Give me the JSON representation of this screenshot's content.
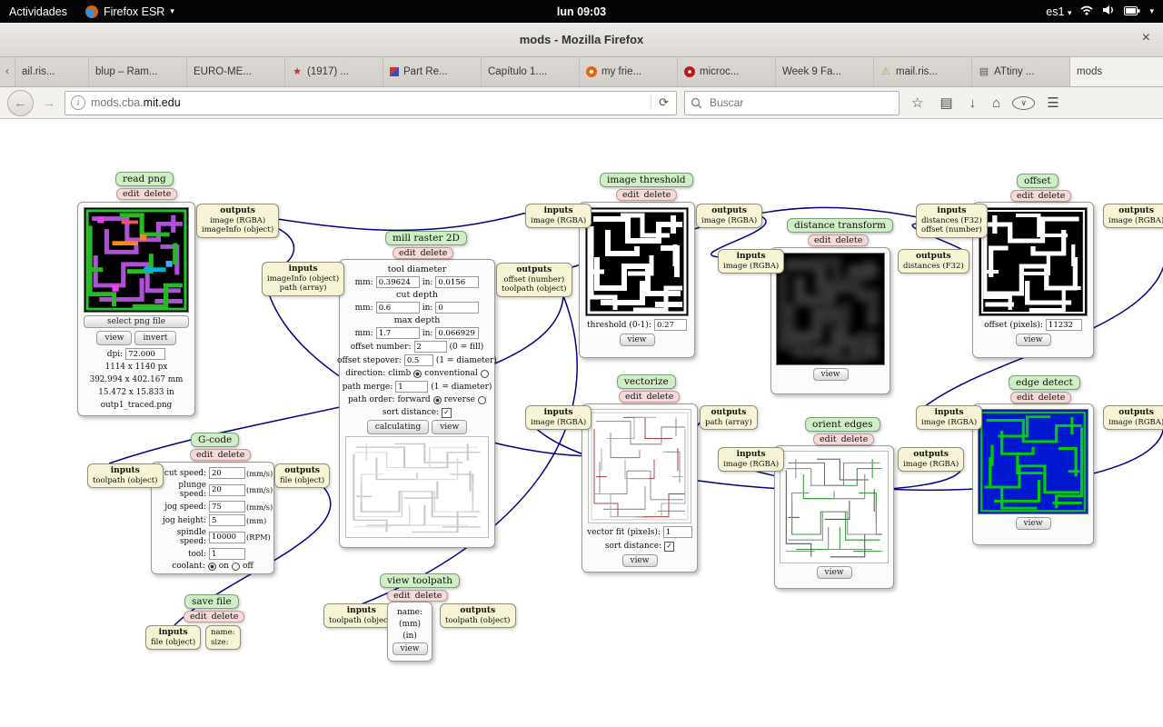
{
  "shell": {
    "activities": "Actividades",
    "app": "Firefox ESR",
    "clock": "lun 09:03",
    "kbd": "es1"
  },
  "window": {
    "title": "mods - Mozilla Firefox"
  },
  "tabbar": {
    "tabs": [
      "ail.ris...",
      "blup – Ram...",
      "EURO-ME...",
      "(1917) ...",
      "Part Re...",
      "Capítulo 1....",
      "my frie...",
      "microc...",
      "Week 9 Fa...",
      "mail.ris...",
      "ATtiny ...",
      "mods"
    ]
  },
  "nav": {
    "url_prefix": "mods.cba.",
    "url_domain": "mit.edu",
    "search_placeholder": "Buscar"
  },
  "glyphs": {
    "back": "←",
    "forward": "→",
    "reload": "⟳",
    "home": "⌂",
    "menu": "☰",
    "download": "↓",
    "bookmark_star": "☆",
    "sidebar": "▤",
    "caret": "▾",
    "scroll_left": "‹",
    "scroll_right": "›",
    "new_tab": "+",
    "close": "×",
    "info": "i",
    "star_fav": "★",
    "warn_fav": "⚠",
    "book_fav": "▤",
    "check": "✓",
    "pocket": "∨"
  },
  "common": {
    "edit": "edit",
    "delete": "delete",
    "inputs": "inputs",
    "outputs": "outputs",
    "view": "view"
  },
  "modules": {
    "read_png": {
      "title": "read png",
      "outputs": [
        "image (RGBA)",
        "imageInfo (object)"
      ],
      "select_btn": "select png file",
      "invert_btn": "invert",
      "dpi_label": "dpi:",
      "dpi": "72.000",
      "info": [
        "1114 x 1140 px",
        "392.994 x 402.167 mm",
        "15.472 x 15.833 in",
        "outp1_traced.png"
      ]
    },
    "mill_raster": {
      "title": "mill raster 2D",
      "inputs": [
        "imageInfo (object)",
        "path (array)"
      ],
      "outputs": [
        "offset (number)",
        "toolpath (object)"
      ],
      "mm": "mm:",
      "in": "in:",
      "tool_diameter": {
        "heading": "tool diameter",
        "mm": "0.39624",
        "in": "0.0156"
      },
      "cut_depth": {
        "heading": "cut depth",
        "mm": "0.6",
        "in": "0"
      },
      "max_depth": {
        "heading": "max depth",
        "mm": "1.7",
        "in": "0.066929"
      },
      "offset_number": {
        "label": "offset number:",
        "value": "2",
        "hint": "(0 = fill)"
      },
      "offset_stepover": {
        "label": "offset stepover:",
        "value": "0.5",
        "hint": "(1 = diameter)"
      },
      "direction": {
        "label": "direction: climb",
        "alt": "conventional"
      },
      "path_merge": {
        "label": "path merge:",
        "value": "1",
        "hint": "(1 = diameter)"
      },
      "path_order": {
        "label": "path order: forward",
        "alt": "reverse"
      },
      "sort_label": "sort distance:",
      "calc_btn": "calculating"
    },
    "image_threshold": {
      "title": "image threshold",
      "inputs": [
        "image (RGBA)"
      ],
      "outputs": [
        "image (RGBA)"
      ],
      "threshold_label": "threshold (0-1):",
      "threshold": "0.27"
    },
    "distance_transform": {
      "title": "distance transform",
      "inputs": [
        "image (RGBA)"
      ],
      "outputs": [
        "distances (F32)"
      ]
    },
    "offset": {
      "title": "offset",
      "inputs": [
        "distances (F32)",
        "offset (number)"
      ],
      "outputs": [
        "image (RGBA)"
      ],
      "offset_label": "offset (pixels):",
      "offset": "11232"
    },
    "edge_detect": {
      "title": "edge detect",
      "inputs": [
        "image (RGBA)"
      ],
      "outputs": [
        "image (RGBA)"
      ]
    },
    "vectorize": {
      "title": "vectorize",
      "inputs": [
        "image (RGBA)"
      ],
      "outputs": [
        "path (array)"
      ],
      "fit_label": "vector fit (pixels):",
      "fit": "1",
      "sort_label": "sort distance:"
    },
    "orient_edges": {
      "title": "orient edges",
      "inputs": [
        "image (RGBA)"
      ],
      "outputs": [
        "image (RGBA)"
      ]
    },
    "gcode": {
      "title": "G-code",
      "inputs": [
        "toolpath (object)"
      ],
      "outputs": [
        "file (object)"
      ],
      "rows": [
        {
          "label": "cut speed:",
          "value": "20",
          "unit": "(mm/s)"
        },
        {
          "label": "plunge speed:",
          "value": "20",
          "unit": "(mm/s)"
        },
        {
          "label": "jog speed:",
          "value": "75",
          "unit": "(mm/s)"
        },
        {
          "label": "jog height:",
          "value": "5",
          "unit": "(mm)"
        },
        {
          "label": "spindle speed:",
          "value": "10000",
          "unit": "(RPM)"
        },
        {
          "label": "tool:",
          "value": "1",
          "unit": ""
        }
      ],
      "coolant": {
        "label": "coolant:",
        "on": "on",
        "off": "off"
      }
    },
    "save_file": {
      "title": "save file",
      "inputs": [
        "file (object)"
      ],
      "name_label": "name:",
      "size_label": "size:"
    },
    "view_toolpath": {
      "title": "view toolpath",
      "inputs": [
        "toolpath (object)"
      ],
      "outputs": [
        "toolpath (object)"
      ],
      "name_label": "name:",
      "mm": "(mm)",
      "in": "(in)"
    }
  }
}
